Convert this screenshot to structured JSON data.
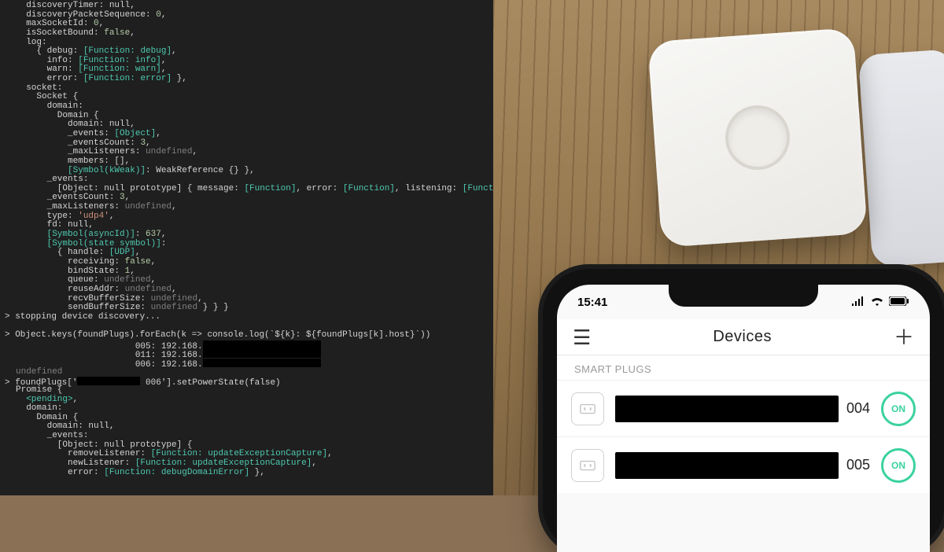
{
  "terminal": {
    "lines": [
      {
        "ind": 1,
        "txt": "discoveryTimer: ",
        "val": "null",
        "cls": "k-null",
        "tail": ","
      },
      {
        "ind": 1,
        "txt": "discoveryPacketSequence: ",
        "val": "0",
        "cls": "k-num",
        "tail": ","
      },
      {
        "ind": 1,
        "txt": "maxSocketId: ",
        "val": "0",
        "cls": "k-num",
        "tail": ","
      },
      {
        "ind": 1,
        "txt": "isSocketBound: ",
        "val": "false",
        "cls": "k-bool",
        "tail": ","
      },
      {
        "ind": 1,
        "txt": "log:"
      },
      {
        "ind": 2,
        "txt": "{ debug: ",
        "fn": "[Function: debug]",
        "tail": ","
      },
      {
        "ind": 3,
        "txt": "info: ",
        "fn": "[Function: info]",
        "tail": ","
      },
      {
        "ind": 3,
        "txt": "warn: ",
        "fn": "[Function: warn]",
        "tail": ","
      },
      {
        "ind": 3,
        "txt": "error: ",
        "fn": "[Function: error]",
        "tail": " },"
      },
      {
        "ind": 1,
        "txt": "socket:"
      },
      {
        "ind": 2,
        "txt": "Socket {"
      },
      {
        "ind": 3,
        "txt": "domain:"
      },
      {
        "ind": 4,
        "txt": "Domain {"
      },
      {
        "ind": 5,
        "txt": "domain: ",
        "val": "null",
        "cls": "k-null",
        "tail": ","
      },
      {
        "ind": 5,
        "txt": "_events: ",
        "sym": "[Object]",
        "tail": ","
      },
      {
        "ind": 5,
        "txt": "_eventsCount: ",
        "val": "3",
        "cls": "k-num",
        "tail": ","
      },
      {
        "ind": 5,
        "txt": "_maxListeners: ",
        "val": "undefined",
        "cls": "k-undef",
        "tail": ","
      },
      {
        "ind": 5,
        "txt": "members: [],"
      },
      {
        "ind": 5,
        "symkey": "[Symbol(kWeak)]",
        "txt2": ": WeakReference {} },"
      },
      {
        "ind": 3,
        "txt": "_events:"
      },
      {
        "ind": 4,
        "txt": "[Object: null prototype] { message: ",
        "fn": "[Function]",
        "mid": ", error: ",
        "fn2": "[Function]",
        "mid2": ", listening: ",
        "fn3": "[Function]",
        "tail": " },"
      },
      {
        "ind": 3,
        "txt": "_eventsCount: ",
        "val": "3",
        "cls": "k-num",
        "tail": ","
      },
      {
        "ind": 3,
        "txt": "_maxListeners: ",
        "val": "undefined",
        "cls": "k-undef",
        "tail": ","
      },
      {
        "ind": 3,
        "txt": "type: ",
        "val": "'udp4'",
        "cls": "k-str",
        "tail": ","
      },
      {
        "ind": 3,
        "txt": "fd: ",
        "val": "null",
        "cls": "k-null",
        "tail": ","
      },
      {
        "ind": 3,
        "symkey": "[Symbol(asyncId)]",
        "txt2": ": ",
        "val": "637",
        "cls": "k-num",
        "tail": ","
      },
      {
        "ind": 3,
        "symkey": "[Symbol(state symbol)]",
        "txt2": ":"
      },
      {
        "ind": 4,
        "txt": "{ handle: ",
        "sym": "[UDP]",
        "tail": ","
      },
      {
        "ind": 5,
        "txt": "receiving: ",
        "val": "false",
        "cls": "k-bool",
        "tail": ","
      },
      {
        "ind": 5,
        "txt": "bindState: ",
        "val": "1",
        "cls": "k-num",
        "tail": ","
      },
      {
        "ind": 5,
        "txt": "queue: ",
        "val": "undefined",
        "cls": "k-undef",
        "tail": ","
      },
      {
        "ind": 5,
        "txt": "reuseAddr: ",
        "val": "undefined",
        "cls": "k-undef",
        "tail": ","
      },
      {
        "ind": 5,
        "txt": "recvBufferSize: ",
        "val": "undefined",
        "cls": "k-undef",
        "tail": ","
      },
      {
        "ind": 5,
        "txt": "sendBufferSize: ",
        "val": "undefined",
        "cls": "k-undef",
        "tail": " } } }"
      },
      {
        "ind": 0,
        "prompt": true,
        "txt": "stopping device discovery..."
      },
      {
        "ind": 0,
        "blank": true
      },
      {
        "ind": 0,
        "prompt": true,
        "txt": "Object.keys(foundPlugs).forEach(k => console.log(`${k}: ${foundPlugs[k].host}`))"
      },
      {
        "ind": 0,
        "raw": "                       005: 192.168.",
        "redact": true
      },
      {
        "ind": 0,
        "raw": "                       011: 192.168.",
        "redact": true
      },
      {
        "ind": 0,
        "raw": "                       006: 192.168.",
        "redact": true
      },
      {
        "ind": 0,
        "dim": true,
        "txt": "undefined"
      },
      {
        "ind": 0,
        "prompt": true,
        "txt": "foundPlugs['",
        "redactSmall": true,
        "txt2": " 006'].setPowerState(false)"
      },
      {
        "ind": 0,
        "txt": "Promise {"
      },
      {
        "ind": 1,
        "pend": "<pending>",
        "tail": ","
      },
      {
        "ind": 1,
        "txt": "domain:"
      },
      {
        "ind": 2,
        "txt": "Domain {"
      },
      {
        "ind": 3,
        "txt": "domain: ",
        "val": "null",
        "cls": "k-null",
        "tail": ","
      },
      {
        "ind": 3,
        "txt": "_events:"
      },
      {
        "ind": 4,
        "txt": "[Object: null prototype] {"
      },
      {
        "ind": 5,
        "txt": "removeListener: ",
        "fn": "[Function: updateExceptionCapture]",
        "tail": ","
      },
      {
        "ind": 5,
        "txt": "newListener: ",
        "fn": "[Function: updateExceptionCapture]",
        "tail": ","
      },
      {
        "ind": 5,
        "txt": "error: ",
        "fn": "[Function: debugDomainError]",
        "tail": " },"
      }
    ]
  },
  "phone": {
    "time": "15:41",
    "signal_icon": "signal-icon",
    "wifi_icon": "wifi-icon",
    "battery_icon": "battery-icon",
    "nav": {
      "menu_icon": "hamburger-icon",
      "title": "Devices",
      "add_icon": "plus-icon"
    },
    "section": "SMART PLUGS",
    "on_label": "ON",
    "rows": [
      {
        "suffix": "004",
        "state": "ON"
      },
      {
        "suffix": "005",
        "state": "ON"
      }
    ]
  }
}
